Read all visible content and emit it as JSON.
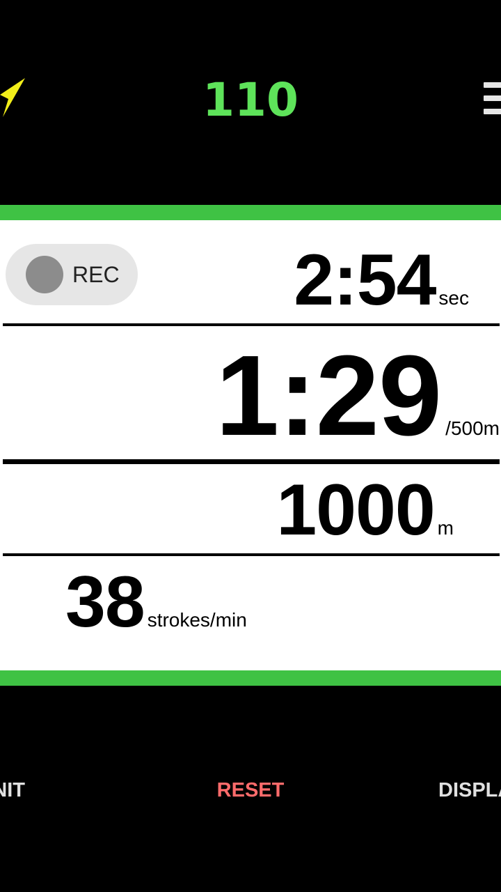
{
  "header": {
    "heart_rate": "110",
    "colors": {
      "heart_rate": "#5ee35a",
      "gps_icon": "#f2ee1a"
    },
    "icons": [
      "gps-arrow-icon",
      "menu-icon"
    ]
  },
  "record": {
    "label": "REC"
  },
  "metrics": {
    "elapsed": {
      "value": "2:54",
      "unit": "sec"
    },
    "split": {
      "value": "1:29",
      "unit": "/500m"
    },
    "distance": {
      "value": "1000",
      "unit": "m"
    },
    "stroke_rate": {
      "value": "38",
      "unit": "strokes/min"
    }
  },
  "footer": {
    "init_label": "INIT",
    "reset_label": "RESET",
    "display_label": "DISPLAY",
    "colors": {
      "reset": "#ff6b6b",
      "accent": "#3fc244"
    }
  }
}
